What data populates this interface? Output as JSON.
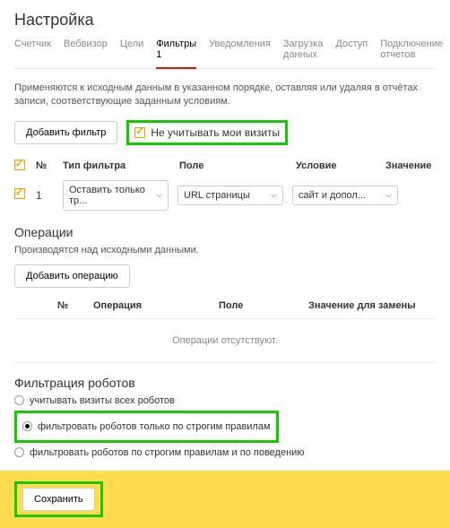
{
  "title": "Настройка",
  "tabs": [
    "Счетчик",
    "Вебвизор",
    "Цели",
    "Фильтры 1",
    "Уведомления",
    "Загрузка данных",
    "Доступ",
    "Подключение отчетов"
  ],
  "desc": "Применяются к исходным данным в указанном порядке, оставляя или удаляя в отчётах записи, соответствующие заданным условиям.",
  "addFilter": "Добавить фильтр",
  "ignoreMy": "Не учитывать мои визиты",
  "th": {
    "n": "№",
    "type": "Тип фильтра",
    "field": "Поле",
    "cond": "Условие",
    "val": "Значение"
  },
  "row": {
    "n": "1",
    "type": "Оставить только тр...",
    "field": "URL страницы",
    "cond": "сайт и допол..."
  },
  "ops": {
    "title": "Операции",
    "sub": "Производятся над исходными данными.",
    "add": "Добавить операцию",
    "th": {
      "n": "№",
      "op": "Операция",
      "field": "Поле",
      "val": "Значение для замены"
    },
    "empty": "Операции отсутствуют."
  },
  "robots": {
    "title": "Фильтрация роботов",
    "r1": "учитывать визиты всех роботов",
    "r2": "фильтровать роботов только по строгим правилам",
    "r3": "фильтровать роботов по строгим правилам и по поведению"
  },
  "save": "Сохранить"
}
